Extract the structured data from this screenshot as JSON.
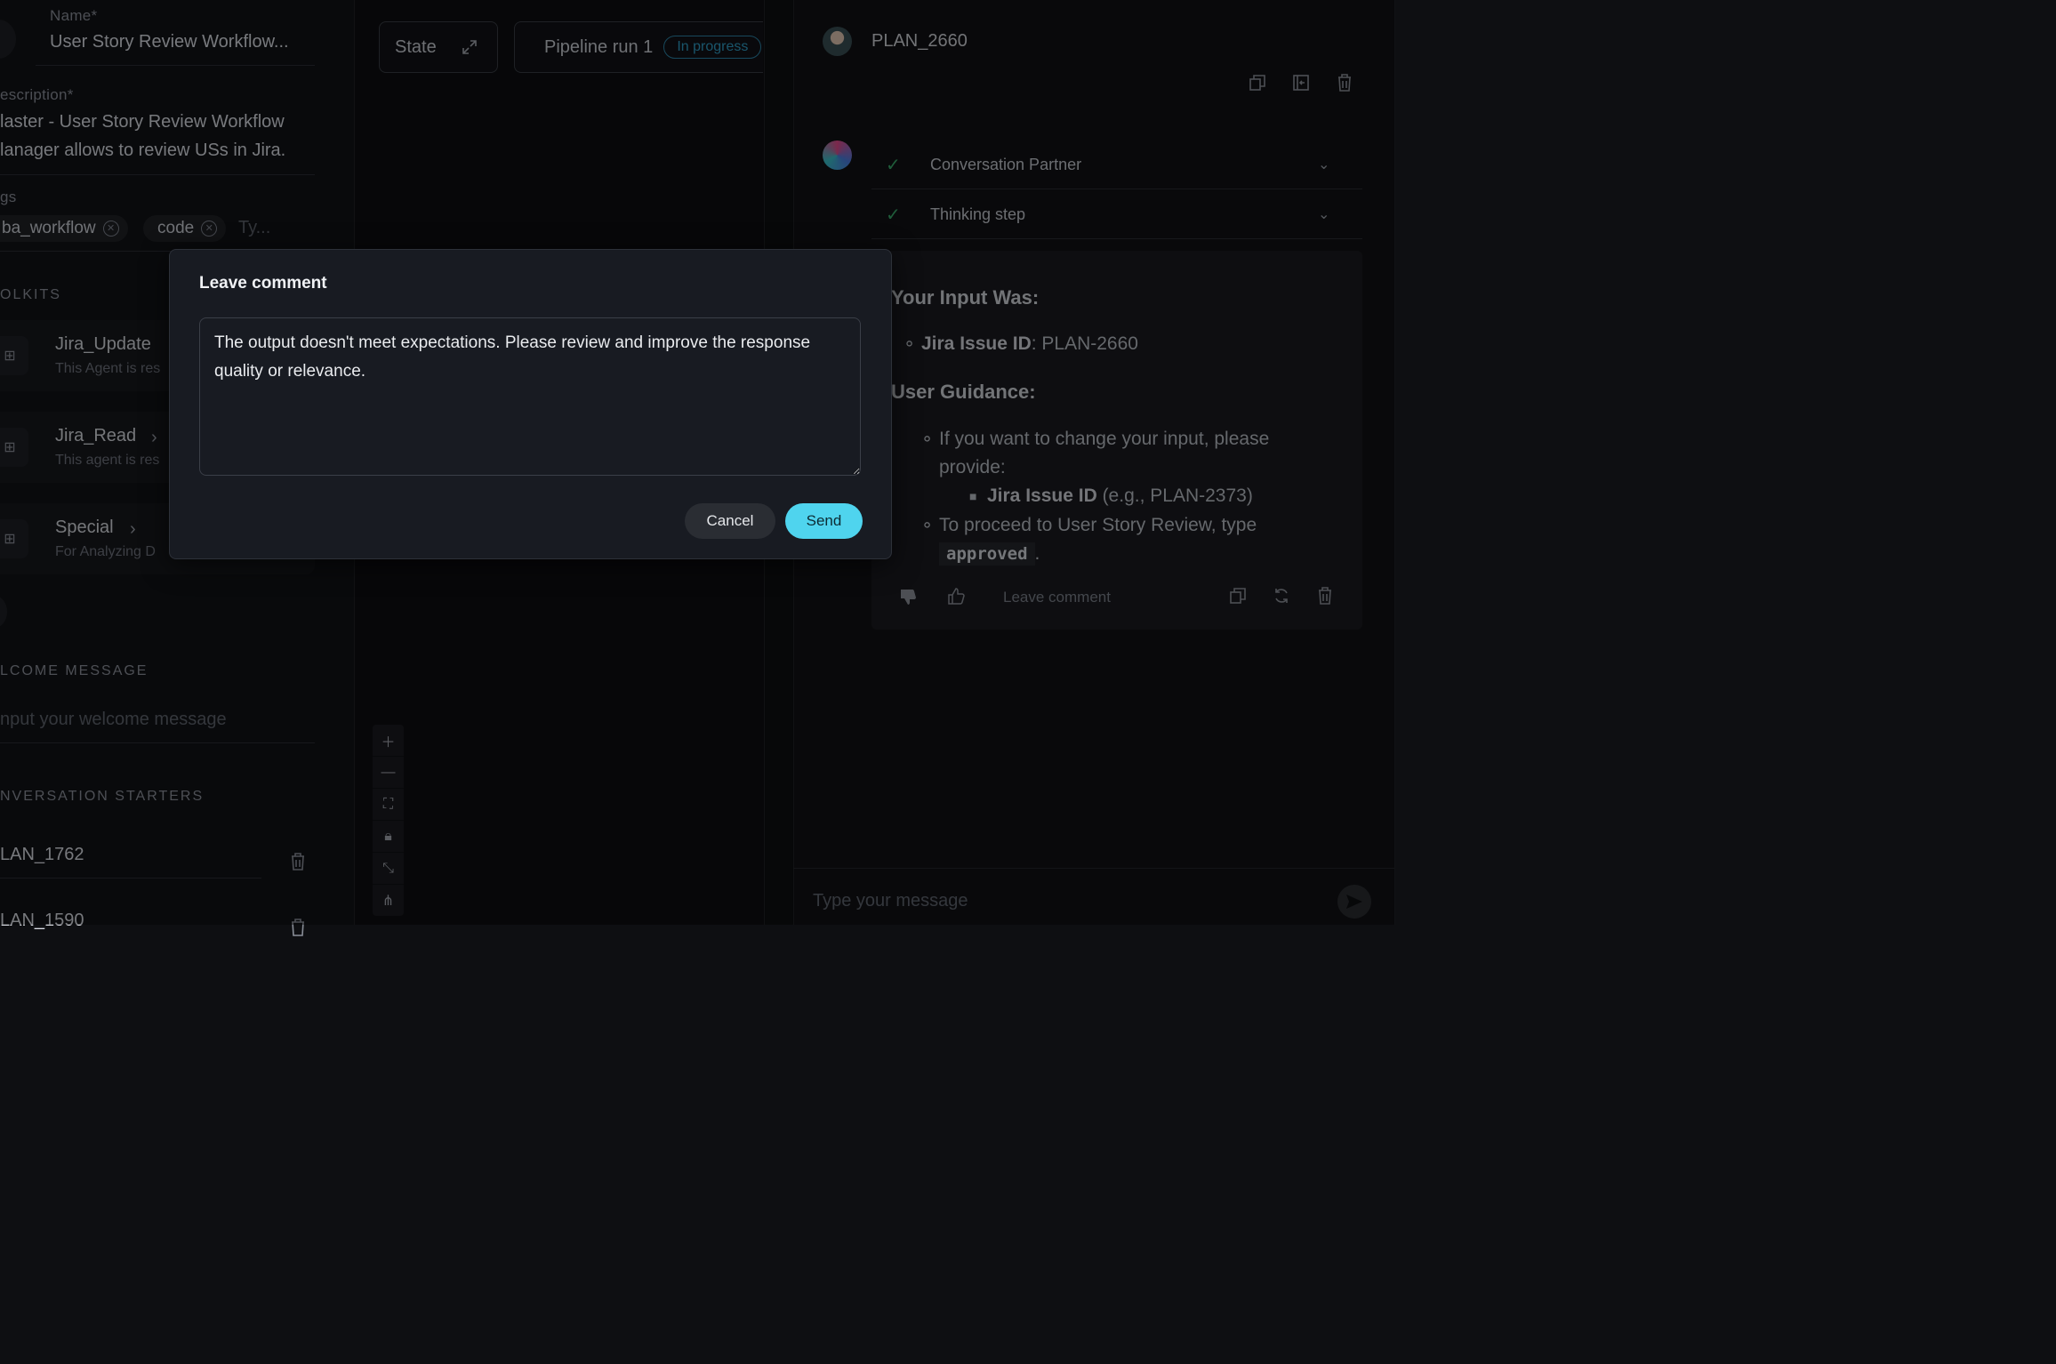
{
  "left": {
    "name_label": "Name*",
    "name_value": "User Story Review Workflow...",
    "description_label": "escription*",
    "description_line1": "laster - User Story Review Workflow",
    "description_line2": "lanager allows to review USs in Jira.",
    "tags_label": "gs",
    "tags": [
      "ba_workflow",
      "code"
    ],
    "tags_placeholder": "Ty...",
    "toolkits_title": "OLKITS",
    "toolkits": [
      {
        "name": "Jira_Update",
        "desc": "This Agent is res"
      },
      {
        "name": "Jira_Read",
        "desc": "This agent is res"
      },
      {
        "name": "Special",
        "desc": "For Analyzing D"
      }
    ],
    "welcome_title": "LCOME MESSAGE",
    "welcome_placeholder": "nput your welcome message",
    "starters_title": "NVERSATION STARTERS",
    "starters": [
      "LAN_1762",
      "LAN_1590"
    ]
  },
  "middle": {
    "state_label": "State",
    "pipeline_label": "Pipeline run 1",
    "status_badge": "In progress"
  },
  "right": {
    "title": "PLAN_2660",
    "accordion": [
      "Conversation Partner",
      "Thinking step"
    ],
    "message": {
      "heading1": "Your Input Was:",
      "issue_label": "Jira Issue ID",
      "issue_value": ": PLAN-2660",
      "heading2": "User Guidance:",
      "guidance_line1": "If you want to change your input, please",
      "guidance_line2": "provide:",
      "sub_label": "Jira Issue ID",
      "sub_value": " (e.g., PLAN-2373)",
      "proceed_text": "To proceed to User Story Review, type",
      "proceed_code": "approved",
      "proceed_end": "."
    },
    "leave_comment": "Leave comment",
    "chat_placeholder": "Type your message"
  },
  "modal": {
    "title": "Leave comment",
    "comment": "The output doesn't meet expectations. Please review and improve the response quality or relevance.",
    "cancel": "Cancel",
    "send": "Send"
  }
}
